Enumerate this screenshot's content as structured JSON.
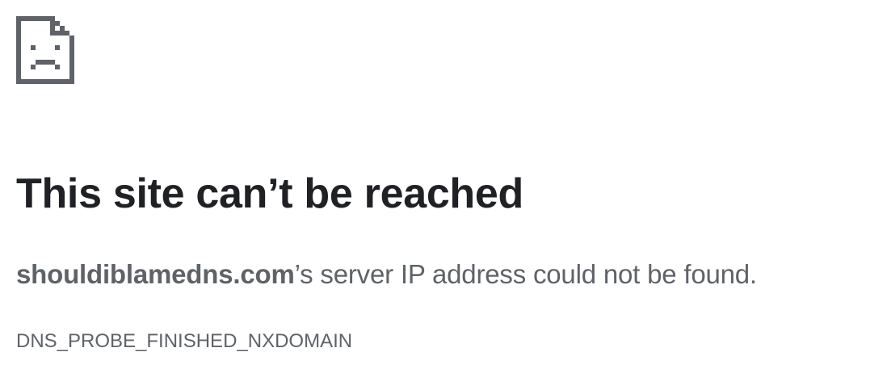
{
  "error_page": {
    "icon": "sad-document-icon",
    "title": "This site can’t be reached",
    "message": {
      "hostname": "shouldiblamedns.com",
      "suffix": "’s server IP address could not be found."
    },
    "error_code": "DNS_PROBE_FINISHED_NXDOMAIN"
  },
  "colors": {
    "title": "#202124",
    "body_text": "#5f6368",
    "icon": "#5f6368",
    "background": "#ffffff"
  }
}
